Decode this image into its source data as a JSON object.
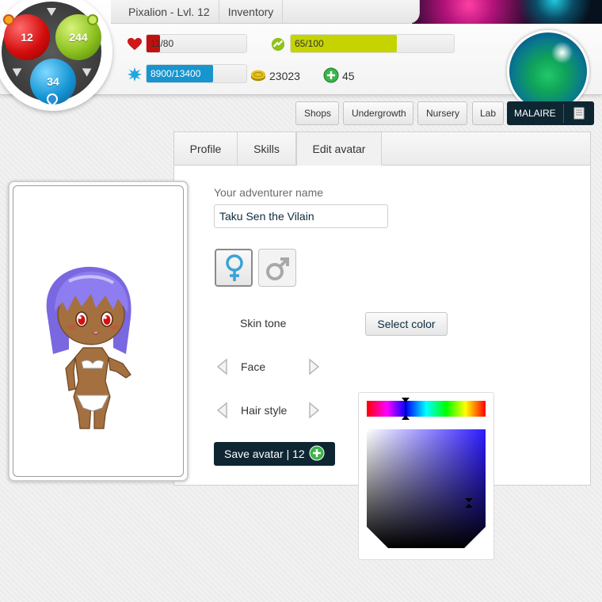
{
  "header": {
    "nav": [
      "Pixalion - Lvl. 12",
      "Inventory"
    ],
    "orbs": {
      "red": "12",
      "green": "244",
      "blue": "34"
    },
    "health": {
      "text": "11/80",
      "fraction": 0.1375,
      "color": "#c40f0f"
    },
    "stamina": {
      "text": "65/100",
      "fraction": 0.65,
      "color": "#c5d400"
    },
    "xp": {
      "text": "8900/13400",
      "fraction": 0.664,
      "color": "#1795cf"
    },
    "gold": "23023",
    "gems": "45"
  },
  "subnav": {
    "items": [
      "Shops",
      "Undergrowth",
      "Nursery",
      "Lab"
    ],
    "user": "MALAIRE"
  },
  "tabs": [
    "Profile",
    "Skills",
    "Edit avatar"
  ],
  "form": {
    "name_label": "Your adventurer name",
    "name_value": "Taku Sen the Vilain",
    "skin_label": "Skin tone",
    "select_color": "Select color",
    "face_label": "Face",
    "hair_label": "Hair style",
    "save_label": "Save avatar | 12",
    "selected_gender": "female"
  },
  "colors": {
    "hair": "#8e7df0",
    "skin": "#a4703f",
    "dark_button": "#0e2632"
  },
  "icons": [
    "heart-icon",
    "lightning-icon",
    "star-burst-icon",
    "gold-coin-icon",
    "gem-plus-icon",
    "female-symbol-icon",
    "male-symbol-icon",
    "scroll-icon",
    "chevron-left-icon",
    "chevron-right-icon"
  ]
}
